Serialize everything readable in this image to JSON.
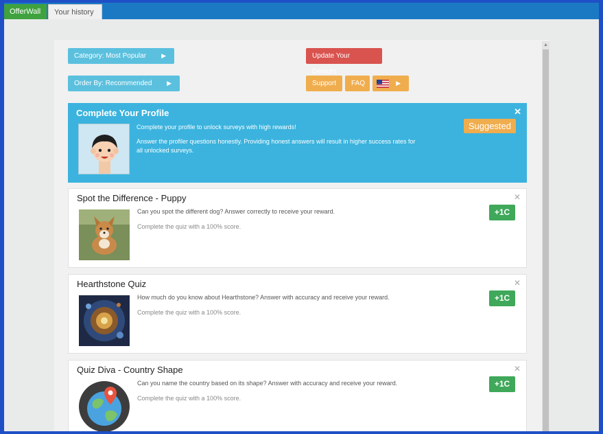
{
  "tabs": {
    "offerwall": "OfferWall",
    "history": "Your history"
  },
  "toolbar": {
    "category": "Category: Most Popular",
    "order": "Order By: Recommended",
    "update": "Update Your Devices",
    "support": "Support",
    "faq": "FAQ"
  },
  "profile": {
    "title": "Complete Your Profile",
    "line1": "Complete your profile to unlock surveys with high rewards!",
    "line2": "Answer the profiler questions honestly. Providing honest answers will result in higher success rates for",
    "line3": "all unlocked surveys.",
    "badge": "Suggested",
    "close": "✕"
  },
  "offers": [
    {
      "title": "Spot the Difference - Puppy",
      "desc": "Can you spot the different dog? Answer correctly to receive your reward.",
      "sub": "Complete the quiz with a 100% score.",
      "reward": "+1C",
      "close": "✕"
    },
    {
      "title": "Hearthstone Quiz",
      "desc": "How much do you know about Hearthstone? Answer with accuracy and receive your reward.",
      "sub": "Complete the quiz with a 100% score.",
      "reward": "+1C",
      "close": "✕"
    },
    {
      "title": "Quiz Diva - Country Shape",
      "desc": "Can you name the country based on its shape? Answer with accuracy and receive your reward.",
      "sub": "Complete the quiz with a 100% score.",
      "reward": "+1C",
      "close": "✕"
    }
  ],
  "icons": {
    "caret": "caret-right-icon",
    "flag": "us-flag-icon"
  }
}
